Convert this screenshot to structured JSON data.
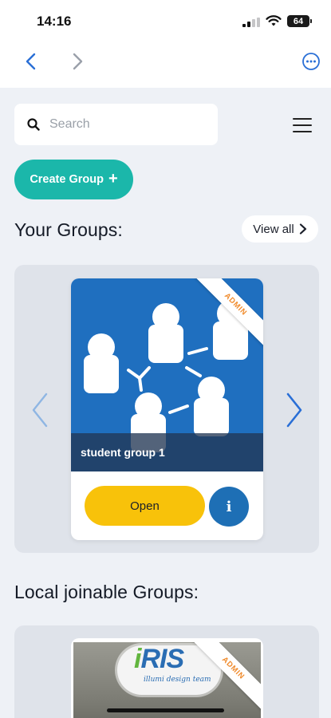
{
  "status_bar": {
    "time": "14:16",
    "battery": "64"
  },
  "browser_nav": {
    "back_icon": "chevron-left-icon",
    "forward_icon": "chevron-right-icon",
    "more_icon": "ellipsis-circle-icon"
  },
  "search": {
    "placeholder": "Search",
    "value": ""
  },
  "toolbar": {
    "create_group_label": "Create Group",
    "create_group_icon": "+"
  },
  "your_groups": {
    "title": "Your Groups:",
    "view_all_label": "View all",
    "cards": [
      {
        "name": "student group 1",
        "badge": "ADMIN",
        "open_label": "Open",
        "info_label": "i"
      }
    ]
  },
  "local_groups": {
    "title": "Local joinable Groups:",
    "cards": [
      {
        "badge": "ADMIN",
        "logo_text": "iRIS",
        "logo_tagline": "iRIS ..."
      }
    ]
  },
  "colors": {
    "teal": "#1bb7aa",
    "yellow": "#f8c20a",
    "blue": "#1e6fb5",
    "orange": "#f08a2a",
    "background": "#eef1f6"
  }
}
